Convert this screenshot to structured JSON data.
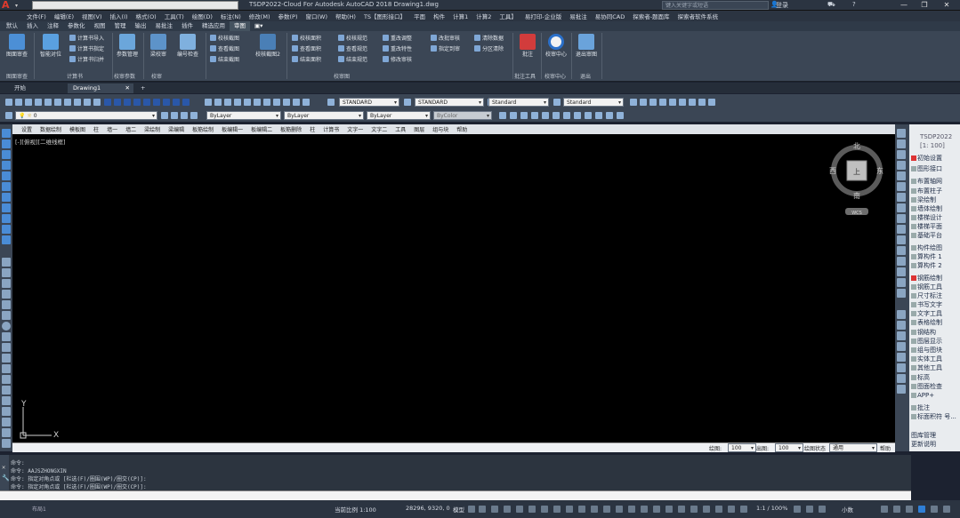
{
  "titlebar": {
    "title": "TSDP2022-Cloud For Autodesk AutoCAD 2018      Drawing1.dwg",
    "search_placeholder": "键入关键字或短语",
    "login": "登录",
    "window_buttons": [
      "—",
      "❐",
      "✕"
    ]
  },
  "menubar": [
    "文件(F)",
    "编辑(E)",
    "视图(V)",
    "插入(I)",
    "格式(O)",
    "工具(T)",
    "绘图(D)",
    "标注(N)",
    "修改(M)",
    "参数(P)",
    "窗口(W)",
    "帮助(H)",
    "TS【图形接口】",
    "平面",
    "构件",
    "计算1",
    "计算2",
    "工具】",
    "易打印-企业版",
    "易批注",
    "易协同CAD",
    "探索者-题面库",
    "探索者软件系统"
  ],
  "ribbon_tabs": [
    "默认",
    "插入",
    "注释",
    "参数化",
    "视图",
    "管理",
    "输出",
    "易批注",
    "插件",
    "精选应用",
    "审图"
  ],
  "active_ribbon_tab": "审图",
  "ribbon": {
    "big_buttons": [
      "图面审查",
      "智能对位",
      "参数管理",
      "梁校审",
      "编号检查",
      "校核截图2",
      "批注",
      "校审中心",
      "退出审图"
    ],
    "small_buttons": {
      "jsx": [
        "计算书导入",
        "计算书指定",
        "计算书归并"
      ],
      "jh": [
        "校核截图",
        "查看截图",
        "结束截图"
      ],
      "jt": [
        "校核面积",
        "查看面积",
        "结束面积"
      ],
      "gf": [
        "校核规范",
        "查看规范",
        "结束规范"
      ],
      "gd": [
        "重改调整",
        "重改特性",
        "修改审核"
      ],
      "sh": [
        "改批审核",
        "指定到审"
      ],
      "qc": [
        "清除数据",
        "分区清除"
      ]
    },
    "panel_titles": [
      "图面审查",
      "计算书",
      "校审参数",
      "校审",
      "说明",
      "校审图",
      "批注工具",
      "校审中心",
      "退出"
    ]
  },
  "doc_tabs": {
    "start": "开始",
    "drawing": "Drawing1",
    "add": "+"
  },
  "toolbar": {
    "text_style": "STANDARD",
    "dim_style": "STANDARD",
    "table_style": "Standard",
    "multileader_style": "Standard",
    "layer": "0",
    "color": "ByLayer",
    "linetype": "ByLayer",
    "lineweight": "ByLayer",
    "plotstyle": "ByColor"
  },
  "tz_menu": [
    "设置",
    "数据绘制",
    "模板图",
    "柱",
    "墙一",
    "墙二",
    "梁绘制",
    "梁编辑",
    "板筋绘制",
    "板编辑一",
    "板编辑二",
    "板筋删除",
    "柱",
    "计算书",
    "文字一",
    "文字二",
    "工具",
    "图层",
    "组与块",
    "帮助"
  ],
  "canvas": {
    "view_label": "[-][俯视][二维线框]",
    "viewcube": {
      "north": "北",
      "south": "南",
      "east": "东",
      "west": "西",
      "top": "上",
      "wcs": "WCS"
    },
    "ucs_x": "X",
    "ucs_y": "Y"
  },
  "tz_panel": {
    "title": "TSDP2022",
    "scale": "[1: 100]",
    "items": [
      "初始设置",
      "图形接口",
      "布置轴网",
      "布置柱子",
      "梁绘制",
      "墙体绘制",
      "楼梯设计",
      "楼梯平面",
      "基础平台",
      "构件绘图",
      "算构件 1",
      "算构件 2",
      "钢筋绘制",
      "钢筋工具",
      "尺寸标注",
      "书写文字",
      "文字工具",
      "表格绘制",
      "钢结构",
      "图层显示",
      "组与图块",
      "实体工具",
      "其他工具",
      "标高",
      "图面检查",
      "APP+",
      "批注",
      "标面积符 号...",
      "图库管理",
      "更新说明"
    ]
  },
  "hscroll": {
    "scale_label1": "绘图:",
    "scale_val1": "100",
    "scale_label2": "出图:",
    "scale_val2": "100",
    "state_label": "绘图状态",
    "state_val": "通用",
    "help": "帮助"
  },
  "command": {
    "lines": [
      "命令:",
      "命令: AAJSZHONGXIN",
      "命令: 指定对角点或 [栏选(F)/圈围(WP)/圈交(CP)]:",
      "命令: 指定对角点或 [栏选(F)/圈围(WP)/圈交(CP)]:"
    ],
    "input_placeholder": ""
  },
  "statusbar": {
    "layout_tab": "布局1",
    "scale_text": "当前比例 1:100",
    "coords": "28296, 9320, 0",
    "model": "模型",
    "annoscale": "1:1 / 100%",
    "units": "小数"
  }
}
